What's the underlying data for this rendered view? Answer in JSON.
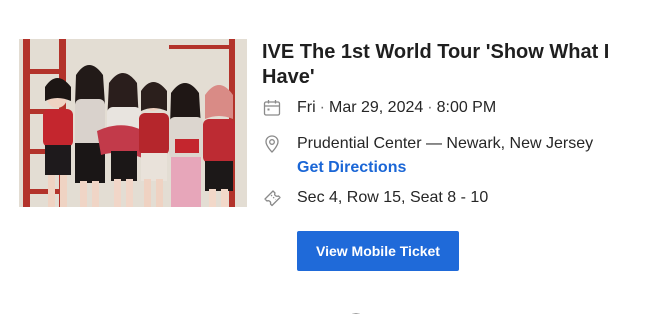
{
  "event": {
    "title": "IVE The 1st World Tour 'Show What I Have'",
    "image_alt": "IVE group photo"
  },
  "date": {
    "day": "Fri",
    "date": "Mar 29, 2024",
    "time": "8:00 PM",
    "icon": "calendar-icon"
  },
  "venue": {
    "name": "Prudential Center — Newark, New Jersey",
    "directions_label": "Get Directions",
    "icon": "location-pin-icon"
  },
  "seats": {
    "text": "Sec 4, Row 15, Seat 8 - 10",
    "icon": "ticket-icon"
  },
  "actions": {
    "view_ticket_label": "View Mobile Ticket"
  },
  "colors": {
    "accent": "#1f6ad9",
    "link": "#1a66d6",
    "text": "#262626",
    "icon": "#8a8a8a"
  }
}
